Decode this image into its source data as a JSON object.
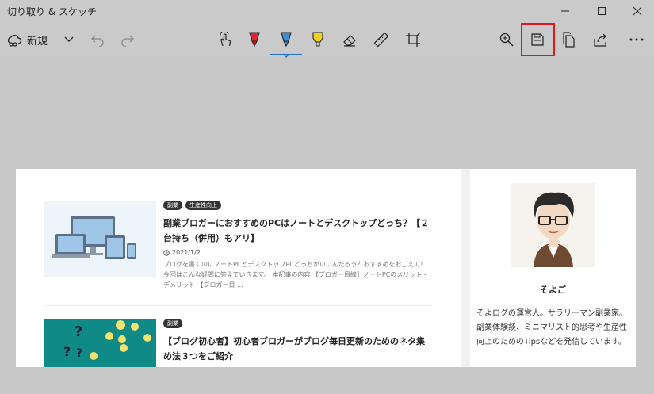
{
  "window": {
    "title": "切り取り & スケッチ"
  },
  "toolbar": {
    "new_label": "新規",
    "icons": [
      "new-snip-icon",
      "chevron-down-icon",
      "undo-icon",
      "redo-icon",
      "touch-writing-icon",
      "ballpoint-pen-icon",
      "pencil-icon",
      "highlighter-icon",
      "eraser-icon",
      "ruler-icon",
      "crop-icon",
      "zoom-icon",
      "save-icon",
      "copy-icon",
      "share-icon",
      "more-icon"
    ],
    "colors": {
      "pen": "#e3242b",
      "pencil_active": "#3a8fd6",
      "highlighter": "#f2d024",
      "active_underline": "#1a73c9",
      "highlight_box": "#e0181e"
    }
  },
  "capture": {
    "posts": [
      {
        "tags": [
          "副業",
          "生産性向上"
        ],
        "title": "副業ブロガーにおすすめのPCはノートとデスクトップどっち？【２台持ち（併用）もアリ】",
        "date": "2021/1/2",
        "excerpt": "ブログを書くのにノートPCとデスクトップPCどっちがいいんだろう？おすすめをおしえて！ 今回はこんな疑問に答えていきます。 本記事の内容 【ブロガー目線】ノートPCのメリット・デメリット 【ブロガー目 ..."
      },
      {
        "tags": [
          "副業"
        ],
        "title": "【ブログ初心者】初心者ブロガーがブログ毎日更新のためのネタ集め法３つをご紹介"
      }
    ],
    "sidebar": {
      "author_name": "そよご",
      "author_bio": "そよログの運営人。サラリーマン副業家。副業体験談、ミニマリスト的思考や生産性向上のためのTipsなどを発信しています。"
    }
  }
}
